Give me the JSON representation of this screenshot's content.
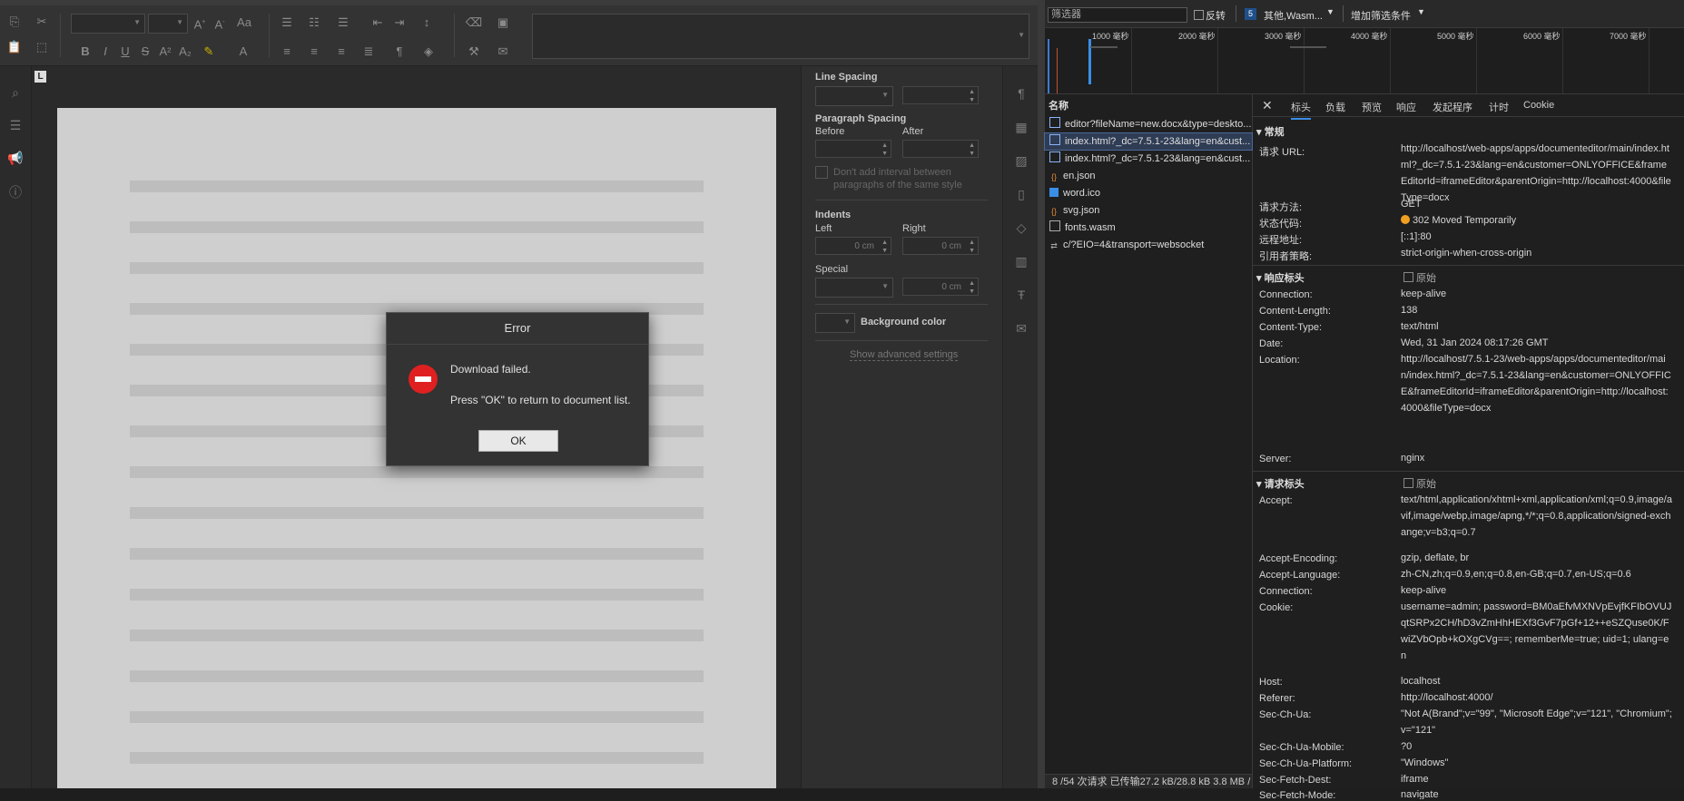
{
  "editor": {
    "settings": {
      "line_spacing": "Line Spacing",
      "paragraph_spacing": "Paragraph Spacing",
      "before": "Before",
      "after": "After",
      "dont_add_interval": "Don't add interval between paragraphs of the same style",
      "indents": "Indents",
      "left": "Left",
      "right": "Right",
      "left_value": "0 cm",
      "right_value": "0 cm",
      "special": "Special",
      "special_value": "0 cm",
      "background_color": "Background color",
      "show_advanced": "Show advanced settings"
    },
    "ruler_tab": "L"
  },
  "dialog": {
    "title": "Error",
    "message1": "Download failed.",
    "message2": "Press \"OK\" to return to document list.",
    "ok_label": "OK"
  },
  "devtools": {
    "filter_placeholder": "筛选器",
    "invert_label": "反转",
    "type_badge": "5",
    "type_filter": "其他,Wasm...",
    "more_filters": "增加筛选条件",
    "timeline_ticks": [
      "1000 毫秒",
      "2000 毫秒",
      "3000 毫秒",
      "4000 毫秒",
      "5000 毫秒",
      "6000 毫秒",
      "7000 毫秒"
    ],
    "name_header": "名称",
    "requests": [
      {
        "name": "editor?fileName=new.docx&type=deskto...",
        "icon": "doc"
      },
      {
        "name": "index.html?_dc=7.5.1-23&lang=en&cust...",
        "icon": "doc"
      },
      {
        "name": "index.html?_dc=7.5.1-23&lang=en&cust...",
        "icon": "doc"
      },
      {
        "name": "en.json",
        "icon": "json"
      },
      {
        "name": "word.ico",
        "icon": "img"
      },
      {
        "name": "svg.json",
        "icon": "json"
      },
      {
        "name": "fonts.wasm",
        "icon": "doc"
      },
      {
        "name": "c/?EIO=4&transport=websocket",
        "icon": "ws"
      }
    ],
    "tabs": [
      "标头",
      "负载",
      "预览",
      "响应",
      "发起程序",
      "计时",
      "Cookie"
    ],
    "general": {
      "title": "常规",
      "rows": [
        {
          "k": "请求 URL:",
          "v": "http://localhost/web-apps/apps/documenteditor/main/index.html?_dc=7.5.1-23&lang=en&customer=ONLYOFFICE&frameEditorId=iframeEditor&parentOrigin=http://localhost:4000&fileType=docx"
        },
        {
          "k": "请求方法:",
          "v": "GET"
        },
        {
          "k": "状态代码:",
          "v": "302 Moved Temporarily"
        },
        {
          "k": "远程地址:",
          "v": "[::1]:80"
        },
        {
          "k": "引用者策略:",
          "v": "strict-origin-when-cross-origin"
        }
      ]
    },
    "response_headers": {
      "title": "响应标头",
      "raw": "原始",
      "rows": [
        {
          "k": "Connection:",
          "v": "keep-alive"
        },
        {
          "k": "Content-Length:",
          "v": "138"
        },
        {
          "k": "Content-Type:",
          "v": "text/html"
        },
        {
          "k": "Date:",
          "v": "Wed, 31 Jan 2024 08:17:26 GMT"
        },
        {
          "k": "Location:",
          "v": "http://localhost/7.5.1-23/web-apps/apps/documenteditor/main/index.html?_dc=7.5.1-23&lang=en&customer=ONLYOFFICE&frameEditorId=iframeEditor&parentOrigin=http://localhost:4000&fileType=docx"
        },
        {
          "k": "Server:",
          "v": "nginx"
        }
      ]
    },
    "request_headers": {
      "title": "请求标头",
      "raw": "原始",
      "rows": [
        {
          "k": "Accept:",
          "v": "text/html,application/xhtml+xml,application/xml;q=0.9,image/avif,image/webp,image/apng,*/*;q=0.8,application/signed-exchange;v=b3;q=0.7"
        },
        {
          "k": "Accept-Encoding:",
          "v": "gzip, deflate, br"
        },
        {
          "k": "Accept-Language:",
          "v": "zh-CN,zh;q=0.9,en;q=0.8,en-GB;q=0.7,en-US;q=0.6"
        },
        {
          "k": "Connection:",
          "v": "keep-alive"
        },
        {
          "k": "Cookie:",
          "v": "username=admin; password=BM0aEfvMXNVpEvjfKFIbOVUJqtSRPx2CH/hD3vZmHhHEXf3GvF7pGf+12++eSZQuse0K/FwiZVbOpb+kOXgCVg==; rememberMe=true; uid=1; ulang=en"
        },
        {
          "k": "Host:",
          "v": "localhost"
        },
        {
          "k": "Referer:",
          "v": "http://localhost:4000/"
        },
        {
          "k": "Sec-Ch-Ua:",
          "v": "\"Not A(Brand\";v=\"99\", \"Microsoft Edge\";v=\"121\", \"Chromium\";v=\"121\""
        },
        {
          "k": "Sec-Ch-Ua-Mobile:",
          "v": "?0"
        },
        {
          "k": "Sec-Ch-Ua-Platform:",
          "v": "\"Windows\""
        },
        {
          "k": "Sec-Fetch-Dest:",
          "v": "iframe"
        },
        {
          "k": "Sec-Fetch-Mode:",
          "v": "navigate"
        }
      ]
    },
    "status_bar": "8 /54 次请求  已传输27.2 kB/28.8 kB  3.8 MB /",
    "colors": {
      "status_dot": "#f0a020",
      "accent": "#3a8ee6"
    }
  }
}
